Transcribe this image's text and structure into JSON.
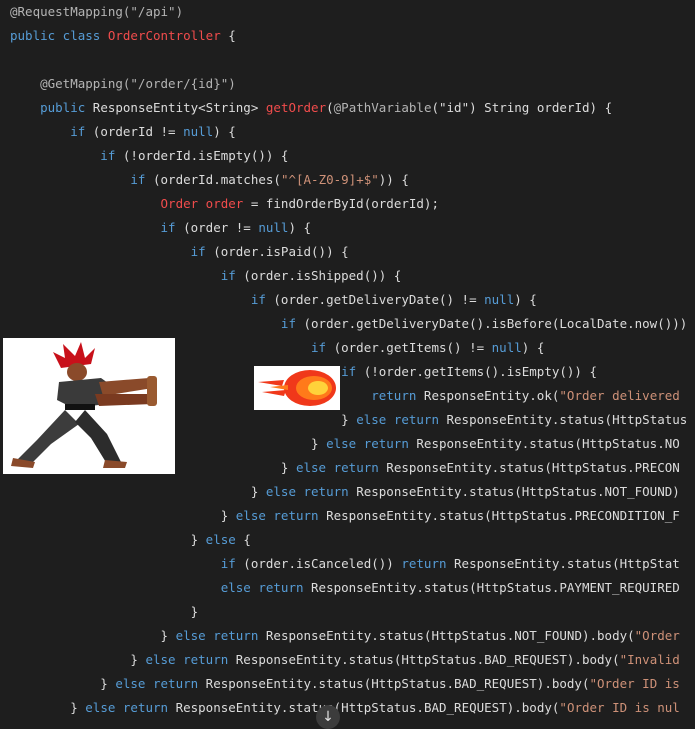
{
  "code": {
    "lines": [
      [
        [
          "@RequestMapping(\"/api\")",
          "ann"
        ]
      ],
      [
        [
          "public class ",
          "kw"
        ],
        [
          "OrderController",
          "cls"
        ],
        [
          " {",
          "pl"
        ]
      ],
      [
        [
          "",
          "pl"
        ]
      ],
      [
        [
          "    @GetMapping(\"/order/{id}\")",
          "ann"
        ]
      ],
      [
        [
          "    public ",
          "kw"
        ],
        [
          "ResponseEntity<String> ",
          "pl"
        ],
        [
          "getOrder",
          "cls"
        ],
        [
          "(",
          "pl"
        ],
        [
          "@PathVariable",
          "ann"
        ],
        [
          "(\"id\") String orderId) {",
          "pl"
        ]
      ],
      [
        [
          "        if ",
          "kw"
        ],
        [
          "(orderId != ",
          "pl"
        ],
        [
          "null",
          "kw"
        ],
        [
          ") {",
          "pl"
        ]
      ],
      [
        [
          "            if ",
          "kw"
        ],
        [
          "(!orderId.isEmpty()) {",
          "pl"
        ]
      ],
      [
        [
          "                if ",
          "kw"
        ],
        [
          "(orderId.matches(",
          "pl"
        ],
        [
          "\"^[A-Z0-9]+$\"",
          "str"
        ],
        [
          ")) {",
          "pl"
        ]
      ],
      [
        [
          "                    Order order ",
          "cls"
        ],
        [
          "= findOrderById(orderId);",
          "pl"
        ]
      ],
      [
        [
          "                    if ",
          "kw"
        ],
        [
          "(order != ",
          "pl"
        ],
        [
          "null",
          "kw"
        ],
        [
          ") {",
          "pl"
        ]
      ],
      [
        [
          "                        if ",
          "kw"
        ],
        [
          "(order.isPaid()) {",
          "pl"
        ]
      ],
      [
        [
          "                            if ",
          "kw"
        ],
        [
          "(order.isShipped()) {",
          "pl"
        ]
      ],
      [
        [
          "                                if ",
          "kw"
        ],
        [
          "(order.getDeliveryDate() != ",
          "pl"
        ],
        [
          "null",
          "kw"
        ],
        [
          ") {",
          "pl"
        ]
      ],
      [
        [
          "                                    if ",
          "kw"
        ],
        [
          "(order.getDeliveryDate().isBefore(LocalDate.now())) {",
          "pl"
        ]
      ],
      [
        [
          "                                        if ",
          "kw"
        ],
        [
          "(order.getItems() != ",
          "pl"
        ],
        [
          "null",
          "kw"
        ],
        [
          ") {",
          "pl"
        ]
      ],
      [
        [
          "                                            if ",
          "kw"
        ],
        [
          "(!order.getItems().isEmpty()) {",
          "pl"
        ]
      ],
      [
        [
          "                                                return ",
          "kw"
        ],
        [
          "ResponseEntity.ok(",
          "pl"
        ],
        [
          "\"Order delivered",
          "str"
        ]
      ],
      [
        [
          "                                            } ",
          "pl"
        ],
        [
          "else return ",
          "kw"
        ],
        [
          "ResponseEntity.status(HttpStatus",
          "pl"
        ]
      ],
      [
        [
          "                                        } ",
          "pl"
        ],
        [
          "else return ",
          "kw"
        ],
        [
          "ResponseEntity.status(HttpStatus.NO",
          "pl"
        ]
      ],
      [
        [
          "                                    } ",
          "pl"
        ],
        [
          "else return ",
          "kw"
        ],
        [
          "ResponseEntity.status(HttpStatus.PRECON",
          "pl"
        ]
      ],
      [
        [
          "                                } ",
          "pl"
        ],
        [
          "else return ",
          "kw"
        ],
        [
          "ResponseEntity.status(HttpStatus.NOT_FOUND)",
          "pl"
        ]
      ],
      [
        [
          "                            } ",
          "pl"
        ],
        [
          "else return ",
          "kw"
        ],
        [
          "ResponseEntity.status(HttpStatus.PRECONDITION_F",
          "pl"
        ]
      ],
      [
        [
          "                        } ",
          "pl"
        ],
        [
          "else ",
          "kw"
        ],
        [
          "{",
          "pl"
        ]
      ],
      [
        [
          "                            if ",
          "kw"
        ],
        [
          "(order.isCanceled()) ",
          "pl"
        ],
        [
          "return ",
          "kw"
        ],
        [
          "ResponseEntity.status(HttpStat",
          "pl"
        ]
      ],
      [
        [
          "                            else return ",
          "kw"
        ],
        [
          "ResponseEntity.status(HttpStatus.PAYMENT_REQUIRED",
          "pl"
        ]
      ],
      [
        [
          "                        }",
          "pl"
        ]
      ],
      [
        [
          "                    } ",
          "pl"
        ],
        [
          "else return ",
          "kw"
        ],
        [
          "ResponseEntity.status(HttpStatus.NOT_FOUND).body(",
          "pl"
        ],
        [
          "\"Order",
          "str"
        ]
      ],
      [
        [
          "                } ",
          "pl"
        ],
        [
          "else return ",
          "kw"
        ],
        [
          "ResponseEntity.status(HttpStatus.BAD_REQUEST).body(",
          "pl"
        ],
        [
          "\"Invalid",
          "str"
        ]
      ],
      [
        [
          "            } ",
          "pl"
        ],
        [
          "else return ",
          "kw"
        ],
        [
          "ResponseEntity.status(HttpStatus.BAD_REQUEST).body(",
          "pl"
        ],
        [
          "\"Order ID is",
          "str"
        ]
      ],
      [
        [
          "        } ",
          "pl"
        ],
        [
          "else return ",
          "kw"
        ],
        [
          "ResponseEntity.stat",
          "pl"
        ],
        [
          "us",
          "pl"
        ],
        [
          "(HttpStatus.BAD_REQUEST).body(",
          "pl"
        ],
        [
          "\"Order ID is nul",
          "str"
        ]
      ]
    ]
  },
  "images": {
    "fighter": "fighter-sprite-image",
    "fireball": "fireball-image"
  },
  "scroll_button": {
    "icon": "arrow-down-icon",
    "glyph": "↓"
  },
  "colors": {
    "background": "#1e1e1e",
    "keyword": "#569cd6",
    "class_name": "#f14c4c",
    "string": "#ce9178",
    "annotation": "#b4b4b4",
    "text": "#dcdcdc"
  }
}
